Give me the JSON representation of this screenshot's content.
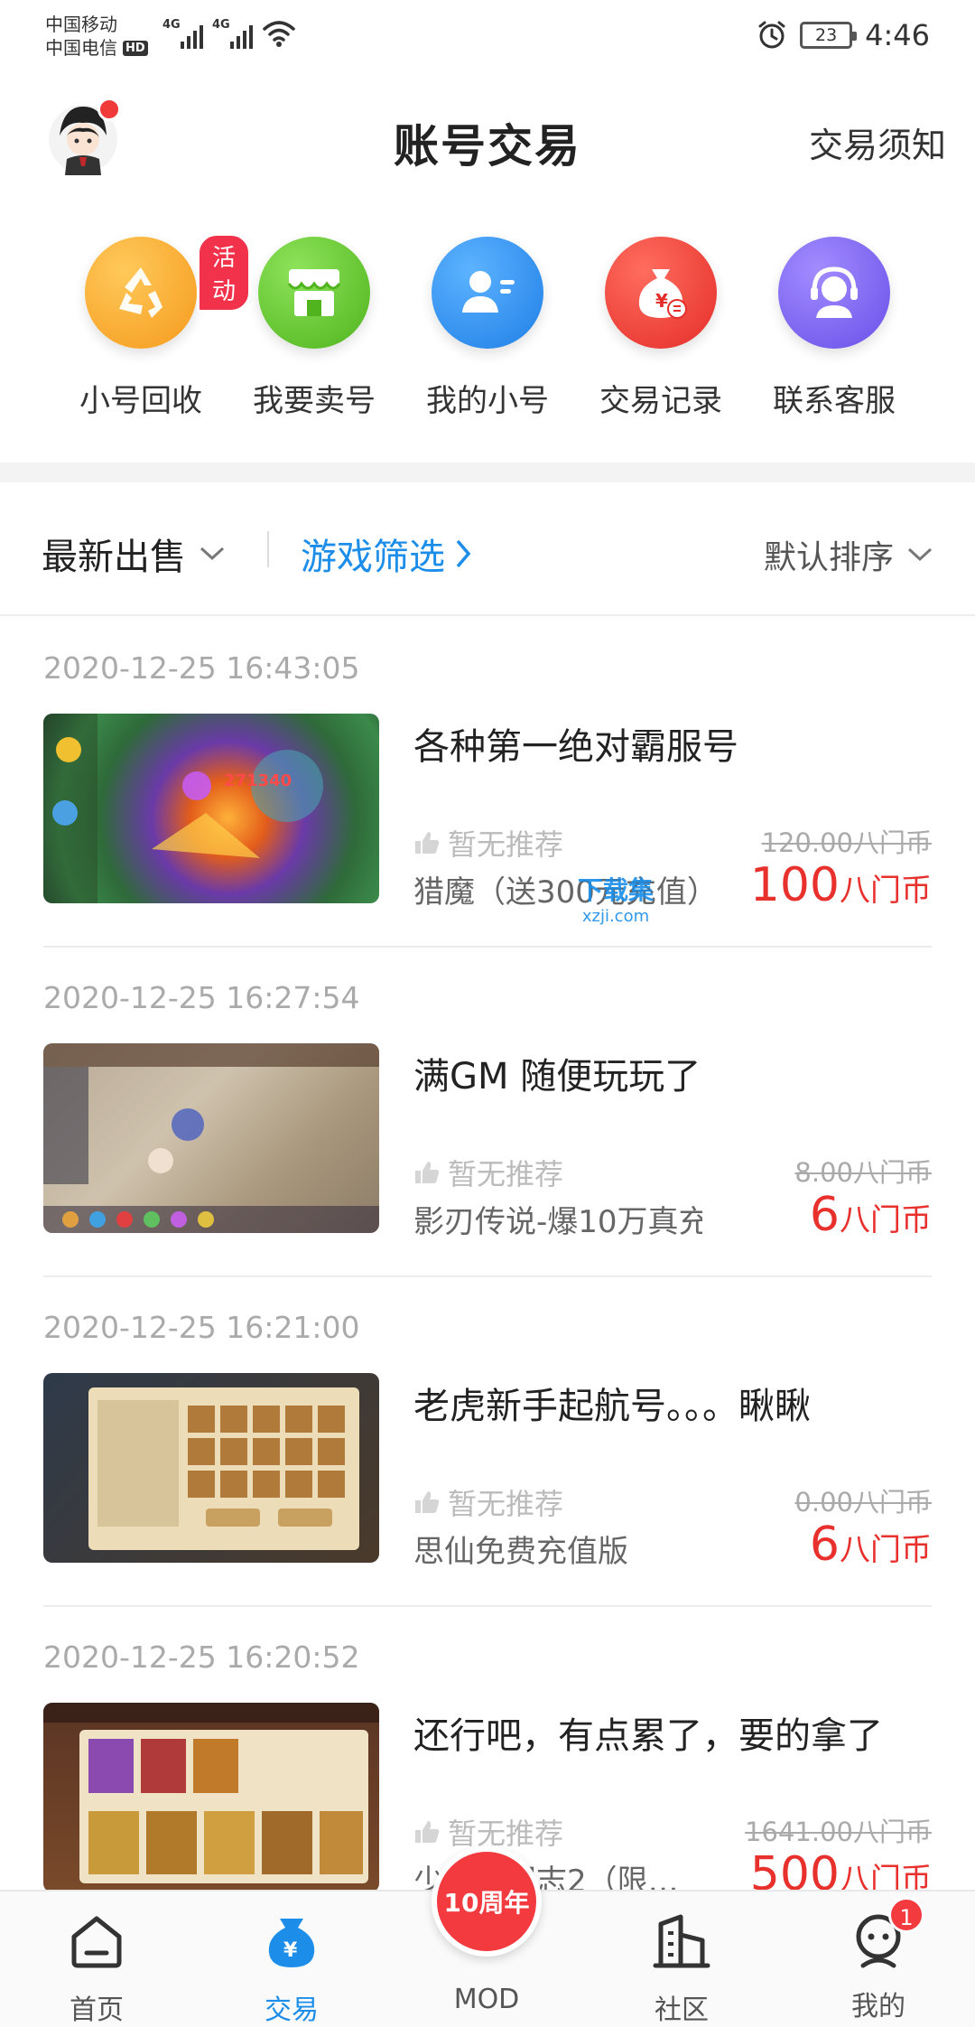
{
  "status_bar": {
    "carrier_1": "中国移动",
    "carrier_2": "中国电信",
    "hd": "HD",
    "net_1": "4G",
    "net_2": "4G",
    "battery": "23",
    "time": "4:46"
  },
  "header": {
    "title": "账号交易",
    "notice": "交易须知"
  },
  "quick_actions": [
    {
      "label": "小号回收",
      "badge": "活动",
      "color": "#f5a623",
      "icon": "recycle-icon"
    },
    {
      "label": "我要卖号",
      "color": "#5fc42b",
      "icon": "shop-icon"
    },
    {
      "label": "我的小号",
      "color": "#2d8fee",
      "icon": "user-card-icon"
    },
    {
      "label": "交易记录",
      "color": "#ef3b36",
      "icon": "money-bag-icon"
    },
    {
      "label": "联系客服",
      "color": "#7a63f0",
      "icon": "headset-icon"
    }
  ],
  "filter_bar": {
    "latest": "最新出售",
    "game_filter": "游戏筛选",
    "sort": "默认排序"
  },
  "listings": [
    {
      "time": "2020-12-25 16:43:05",
      "title": "各种第一绝对霸服号",
      "recommend": "暂无推荐",
      "game": "猎魔（送300元充值）",
      "original_price": "120.00八门币",
      "price": "100",
      "unit": "八门币"
    },
    {
      "time": "2020-12-25 16:27:54",
      "title": "满GM 随便玩玩了",
      "recommend": "暂无推荐",
      "game": "影刃传说-爆10万真充",
      "original_price": "8.00八门币",
      "price": "6",
      "unit": "八门币"
    },
    {
      "time": "2020-12-25 16:21:00",
      "title": "老虎新手起航号。。。瞅瞅",
      "recommend": "暂无推荐",
      "game": "思仙免费充值版",
      "original_price": "0.00八门币",
      "price": "6",
      "unit": "八门币"
    },
    {
      "time": "2020-12-25 16:20:52",
      "title": "还行吧，有点累了，要的拿了",
      "recommend": "暂无推荐",
      "game": "少年三国志2（限…",
      "original_price": "1641.00八门币",
      "price": "500",
      "unit": "八门币"
    }
  ],
  "watermark": {
    "top": "下载集",
    "bottom": "xzji.com"
  },
  "bottom_nav": {
    "home": "首页",
    "trade": "交易",
    "mod": "MOD",
    "mod_badge": "10周年",
    "community": "社区",
    "mine": "我的",
    "mine_badge": "1"
  }
}
